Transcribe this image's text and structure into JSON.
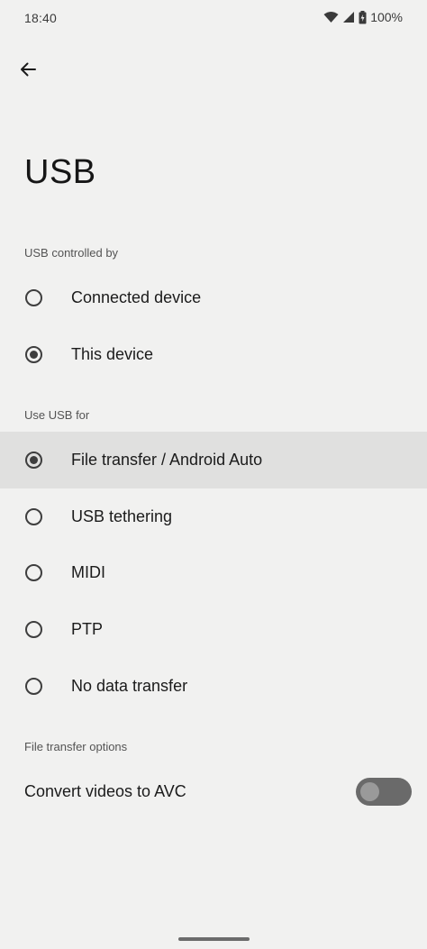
{
  "status_bar": {
    "time": "18:40",
    "battery": "100%",
    "icons": [
      "wifi-icon",
      "cell-signal-icon",
      "battery-charging-icon"
    ]
  },
  "header": {
    "back_icon": "arrow-back-icon",
    "title": "USB"
  },
  "usb_controlled_by": {
    "heading": "USB controlled by",
    "options": [
      {
        "label": "Connected device",
        "selected": false
      },
      {
        "label": "This device",
        "selected": true
      }
    ]
  },
  "use_usb_for": {
    "heading": "Use USB for",
    "options": [
      {
        "label": "File transfer / Android Auto",
        "selected": true
      },
      {
        "label": "USB tethering",
        "selected": false
      },
      {
        "label": "MIDI",
        "selected": false
      },
      {
        "label": "PTP",
        "selected": false
      },
      {
        "label": "No data transfer",
        "selected": false
      }
    ]
  },
  "file_transfer_options": {
    "heading": "File transfer options",
    "convert_videos": {
      "label": "Convert videos to AVC",
      "enabled": false
    }
  },
  "colors": {
    "background": "#f1f1f0",
    "highlight": "#e0e0df",
    "radio": "#3e3e3e",
    "switch_track": "#6a6a6a",
    "switch_thumb": "#9a9a9a"
  }
}
